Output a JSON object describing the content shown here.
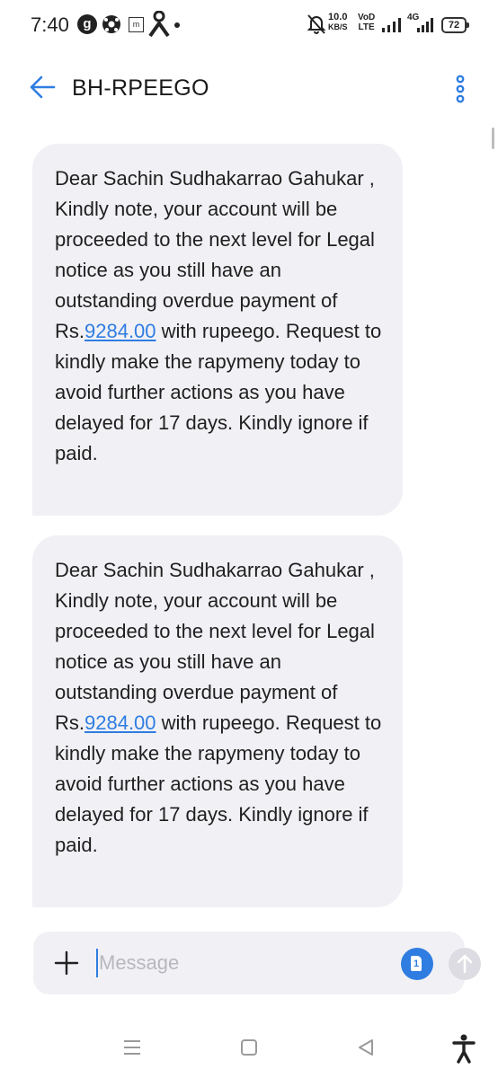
{
  "status_bar": {
    "time": "7:40",
    "g_badge": "g",
    "m_badge": "m",
    "net_speed_value": "10.0",
    "net_speed_unit": "KB/S",
    "volte_top": "VoD",
    "volte_bottom": "LTE",
    "network_type": "4G",
    "battery": "72"
  },
  "header": {
    "title": "BH-RPEEGO"
  },
  "messages": [
    {
      "text_before_amount": "Dear Sachin Sudhakarrao Gahukar ,  Kindly note, your account will be proceeded to the next level for Legal notice as you still have an outstanding overdue payment of Rs.",
      "amount": "9284.00",
      "text_after_amount": " with rupeego.  Request to kindly make the rapymeny today to avoid further actions as you have delayed for 17 days. Kindly ignore if paid."
    },
    {
      "text_before_amount": "Dear Sachin Sudhakarrao Gahukar ,  Kindly note, your account will be proceeded to the next level for Legal notice as you still have an outstanding overdue payment of Rs.",
      "amount": "9284.00",
      "text_after_amount": " with rupeego.  Request to kindly make the rapymeny today to avoid further actions as you have delayed for 17 days. Kindly ignore if paid."
    }
  ],
  "composer": {
    "placeholder": "Message",
    "value": "",
    "sim_label": "1"
  },
  "icons": {
    "back": "arrow-left-icon",
    "more": "more-vertical-icon",
    "add": "plus-icon",
    "sim": "sim-card-icon",
    "send": "send-arrow-icon",
    "nav_recents": "menu-lines-icon",
    "nav_home": "square-icon",
    "nav_back": "triangle-back-icon",
    "accessibility": "accessibility-icon"
  },
  "colors": {
    "accent": "#2f7de1",
    "bubble_bg": "#f1f1f5",
    "send_disabled": "#dcdce2"
  }
}
